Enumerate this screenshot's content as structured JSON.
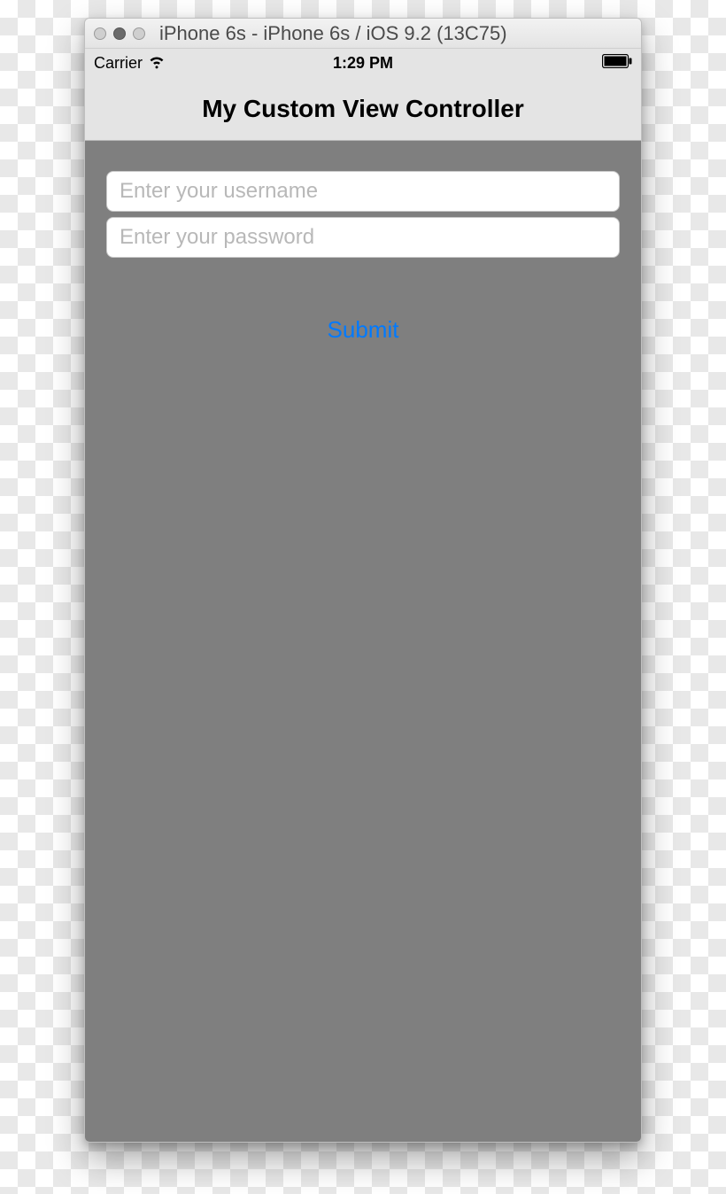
{
  "window": {
    "title": "iPhone 6s - iPhone 6s / iOS 9.2 (13C75)"
  },
  "status_bar": {
    "carrier": "Carrier",
    "time": "1:29 PM"
  },
  "nav": {
    "title": "My Custom View Controller"
  },
  "form": {
    "username_placeholder": "Enter your username",
    "password_placeholder": "Enter your password",
    "submit_label": "Submit"
  }
}
